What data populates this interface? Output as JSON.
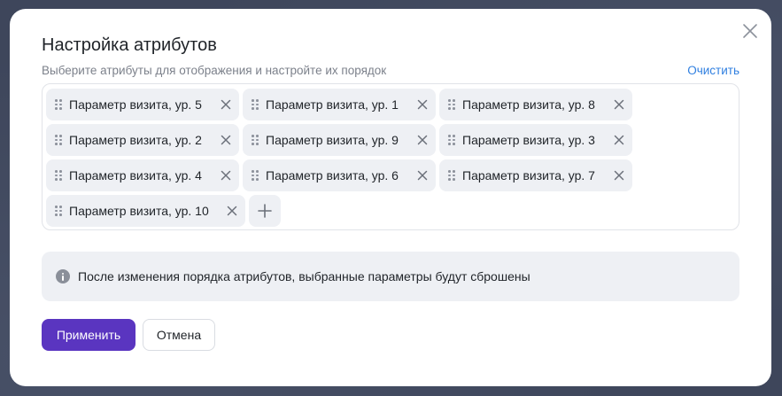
{
  "modal": {
    "title": "Настройка атрибутов",
    "subtitle": "Выберите атрибуты для отображения и настройте их порядок",
    "clear_label": "Очистить",
    "chips": [
      "Параметр визита, ур. 5",
      "Параметр визита, ур. 1",
      "Параметр визита, ур. 8",
      "Параметр визита, ур. 2",
      "Параметр визита, ур. 9",
      "Параметр визита, ур. 3",
      "Параметр визита, ур. 4",
      "Параметр визита, ур. 6",
      "Параметр визита, ур. 7",
      "Параметр визита, ур. 10"
    ],
    "info_text": "После изменения порядка атрибутов, выбранные параметры будут сброшены",
    "apply_label": "Применить",
    "cancel_label": "Отмена"
  },
  "colors": {
    "accent": "#5a35c0",
    "link": "#2f7fe0",
    "chip_bg": "#eef0f4"
  },
  "icons": {
    "close": "close-icon",
    "drag": "drag-handle-icon",
    "remove": "remove-icon",
    "add": "plus-icon",
    "info": "info-icon"
  }
}
